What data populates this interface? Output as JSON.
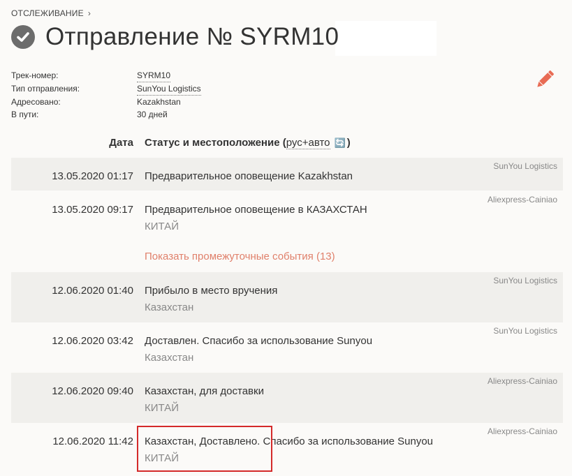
{
  "breadcrumb": {
    "label": "ОТСЛЕЖИВАНИЕ",
    "chevron": "›"
  },
  "header": {
    "title": "Отправление № SYRM10"
  },
  "info": {
    "track_label": "Трек-номер:",
    "track_value": "SYRM10",
    "type_label": "Тип отправления:",
    "type_value": "SunYou Logistics",
    "address_label": "Адресовано:",
    "address_value": "Kazakhstan",
    "transit_label": "В пути:",
    "transit_value": "30 дней"
  },
  "table": {
    "date_header": "Дата",
    "status_header_prefix": "Статус и местоположение (",
    "lang_toggle": "рус+авто",
    "status_header_suffix": ")",
    "events": [
      {
        "date": "13.05.2020 01:17",
        "status": "Предварительное оповещение Kazakhstan",
        "location": "",
        "source": "SunYou Logistics"
      },
      {
        "date": "13.05.2020 09:17",
        "status": "Предварительное оповещение в КАЗАХСТАН",
        "location": "КИТАЙ",
        "source": "Aliexpress-Cainiao"
      },
      {
        "date": "12.06.2020 01:40",
        "status": "Прибыло в место вручения",
        "location": "Казахстан",
        "source": "SunYou Logistics"
      },
      {
        "date": "12.06.2020 03:42",
        "status": "Доставлен. Спасибо за использование Sunyou",
        "location": "Казахстан",
        "source": "SunYou Logistics"
      },
      {
        "date": "12.06.2020 09:40",
        "status": "Казахстан, для доставки",
        "location": "КИТАЙ",
        "source": "Aliexpress-Cainiao"
      },
      {
        "date": "12.06.2020 11:42",
        "status": "Казахстан, Доставлено. Спасибо за использование Sunyou",
        "location": "КИТАЙ",
        "source": "Aliexpress-Cainiao"
      }
    ],
    "show_events_label": "Показать промежуточные события (13)"
  },
  "colors": {
    "accent": "#e0806b",
    "pencil": "#e86b54",
    "highlight": "#d42a2a",
    "row_shade": "#f0efec"
  },
  "icons": {
    "check": "check-circle-icon",
    "edit": "pencil-icon",
    "translate": "translate-icon"
  }
}
